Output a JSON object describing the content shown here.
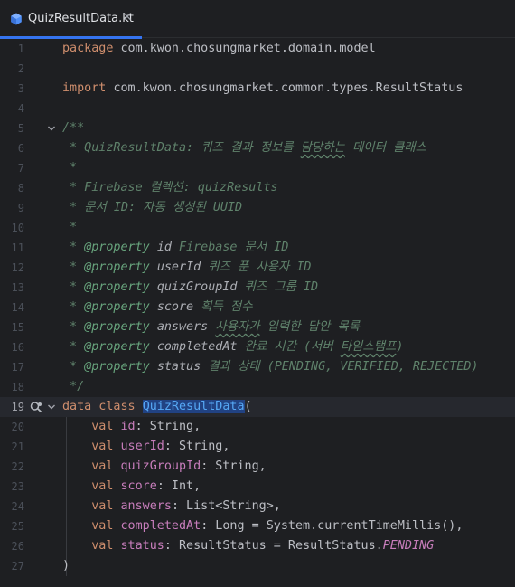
{
  "tab": {
    "file_name": "QuizResultData.kt",
    "close_glyph": "✕",
    "icon": "kotlin-file-icon",
    "accent_color": "#3574f0"
  },
  "lines": [
    {
      "num": "1",
      "text": "package com.kwon.chosungmarket.domain.model"
    },
    {
      "num": "2",
      "text": ""
    },
    {
      "num": "3",
      "text": "import com.kwon.chosungmarket.common.types.ResultStatus"
    },
    {
      "num": "4",
      "text": ""
    },
    {
      "num": "5",
      "text": "/**"
    },
    {
      "num": "6",
      "text": " * QuizResultData: 퀴즈 결과 정보를 담당하는 데이터 클래스"
    },
    {
      "num": "7",
      "text": " *"
    },
    {
      "num": "8",
      "text": " * Firebase 컬렉션: quizResults"
    },
    {
      "num": "9",
      "text": " * 문서 ID: 자동 생성된 UUID"
    },
    {
      "num": "10",
      "text": " *"
    },
    {
      "num": "11",
      "text": " * @property id Firebase 문서 ID"
    },
    {
      "num": "12",
      "text": " * @property userId 퀴즈 푼 사용자 ID"
    },
    {
      "num": "13",
      "text": " * @property quizGroupId 퀴즈 그룹 ID"
    },
    {
      "num": "14",
      "text": " * @property score 획득 점수"
    },
    {
      "num": "15",
      "text": " * @property answers 사용자가 입력한 답안 목록"
    },
    {
      "num": "16",
      "text": " * @property completedAt 완료 시간 (서버 타임스탬프)"
    },
    {
      "num": "17",
      "text": " * @property status 결과 상태 (PENDING, VERIFIED, REJECTED)"
    },
    {
      "num": "18",
      "text": " */"
    },
    {
      "num": "19",
      "text": "data class QuizResultData("
    },
    {
      "num": "20",
      "text": "    val id: String,"
    },
    {
      "num": "21",
      "text": "    val userId: String,"
    },
    {
      "num": "22",
      "text": "    val quizGroupId: String,"
    },
    {
      "num": "23",
      "text": "    val score: Int,"
    },
    {
      "num": "24",
      "text": "    val answers: List<String>,"
    },
    {
      "num": "25",
      "text": "    val completedAt: Long = System.currentTimeMillis(),"
    },
    {
      "num": "26",
      "text": "    val status: ResultStatus = ResultStatus.PENDING"
    },
    {
      "num": "27",
      "text": ")"
    }
  ],
  "highlight": {
    "current_line": "19",
    "selected_text": "QuizResultData"
  },
  "colors": {
    "background": "#1e1f22",
    "keyword": "#cf8e6d",
    "property": "#c77dbb",
    "doc_comment": "#5f826b",
    "selection": "#214283"
  }
}
